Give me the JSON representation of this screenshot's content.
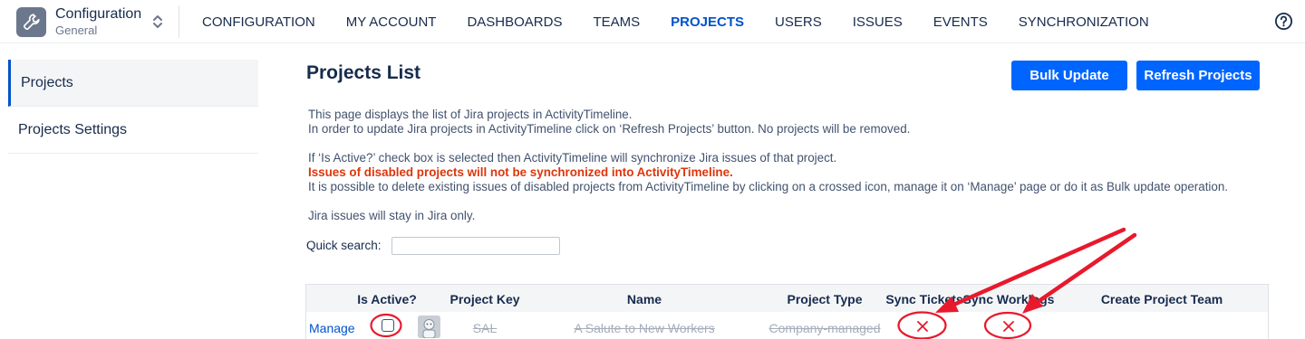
{
  "app": {
    "title": "Configuration",
    "subtitle": "General"
  },
  "nav": [
    {
      "label": "CONFIGURATION",
      "active": false
    },
    {
      "label": "MY ACCOUNT",
      "active": false
    },
    {
      "label": "DASHBOARDS",
      "active": false
    },
    {
      "label": "TEAMS",
      "active": false
    },
    {
      "label": "PROJECTS",
      "active": true
    },
    {
      "label": "USERS",
      "active": false
    },
    {
      "label": "ISSUES",
      "active": false
    },
    {
      "label": "EVENTS",
      "active": false
    },
    {
      "label": "SYNCHRONIZATION",
      "active": false
    }
  ],
  "sidebar": {
    "items": [
      {
        "label": "Projects",
        "active": true
      },
      {
        "label": "Projects Settings",
        "active": false
      }
    ]
  },
  "main": {
    "title": "Projects List",
    "bulk_update_label": "Bulk Update",
    "refresh_label": "Refresh Projects",
    "desc": {
      "line1": "This page displays the list of Jira projects in ActivityTimeline.",
      "line2": "In order to update Jira projects in ActivityTimeline click on ‘Refresh Projects’ button. No projects will be removed.",
      "line3": "If ‘Is Active?’ check box is selected then ActivityTimeline will synchronize Jira issues of that project.",
      "warning": "Issues of disabled projects will not be synchronized into ActivityTimeline.",
      "line4": "It is possible to delete existing issues of disabled projects from ActivityTimeline by clicking on a crossed icon, manage it on ‘Manage’ page or do it as Bulk update operation.",
      "line5": "Jira issues will stay in Jira only."
    },
    "search": {
      "label": "Quick search:",
      "value": ""
    }
  },
  "table": {
    "columns": {
      "is_active": "Is Active?",
      "project_key": "Project Key",
      "name": "Name",
      "project_type": "Project Type",
      "sync_tickets": "Sync Tickets",
      "sync_worklogs": "Sync Worklogs",
      "create_team": "Create Project Team"
    },
    "rows": [
      {
        "manage": "Manage",
        "is_active": false,
        "key": "SAL",
        "name": "A Salute to New Workers",
        "type": "Company-managed",
        "sync_tickets": false,
        "sync_worklogs": false
      }
    ]
  },
  "colors": {
    "accent": "#0052cc",
    "button": "#0065ff",
    "warning": "#de350b",
    "annotation": "#e8192c"
  },
  "icons": {
    "app_logo": "wrench-icon",
    "app_switch": "chevron-up-down-icon",
    "help": "question-circle-icon",
    "project_avatar": "project-avatar-icon",
    "sync_disabled": "red-cross-icon"
  }
}
